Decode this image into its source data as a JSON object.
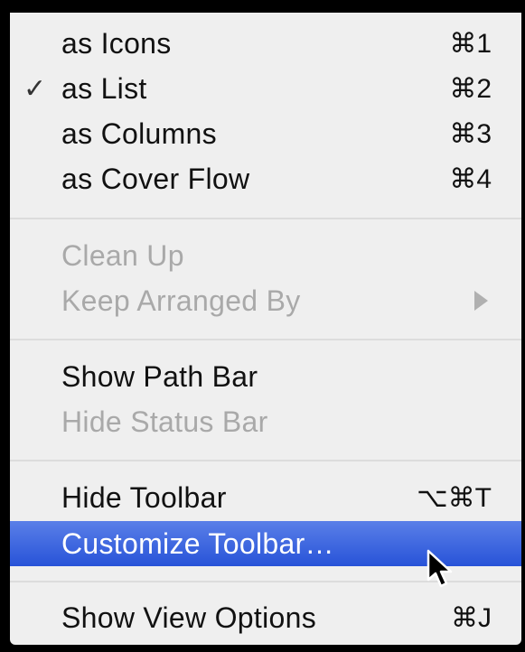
{
  "menu": {
    "view_modes": [
      {
        "label": "as Icons",
        "shortcut": "⌘1",
        "checked": false
      },
      {
        "label": "as List",
        "shortcut": "⌘2",
        "checked": true
      },
      {
        "label": "as Columns",
        "shortcut": "⌘3",
        "checked": false
      },
      {
        "label": "as Cover Flow",
        "shortcut": "⌘4",
        "checked": false
      }
    ],
    "checkmark": "✓",
    "clean_up": {
      "label": "Clean Up",
      "enabled": false
    },
    "keep_arranged_by": {
      "label": "Keep Arranged By",
      "enabled": false,
      "has_submenu": true
    },
    "show_path_bar": {
      "label": "Show Path Bar",
      "enabled": true
    },
    "hide_status_bar": {
      "label": "Hide Status Bar",
      "enabled": false
    },
    "hide_toolbar": {
      "label": "Hide Toolbar",
      "shortcut": "⌥⌘T"
    },
    "customize_toolbar": {
      "label": "Customize Toolbar…",
      "highlighted": true
    },
    "show_view_options": {
      "label": "Show View Options",
      "shortcut": "⌘J"
    }
  },
  "colors": {
    "highlight": "#3461dd",
    "disabled_text": "#a9a9a9",
    "menu_background": "#f7f7f7"
  },
  "icons": {
    "checkmark": "checkmark-icon",
    "submenu": "submenu-arrow-icon",
    "cursor": "mouse-pointer-icon"
  }
}
